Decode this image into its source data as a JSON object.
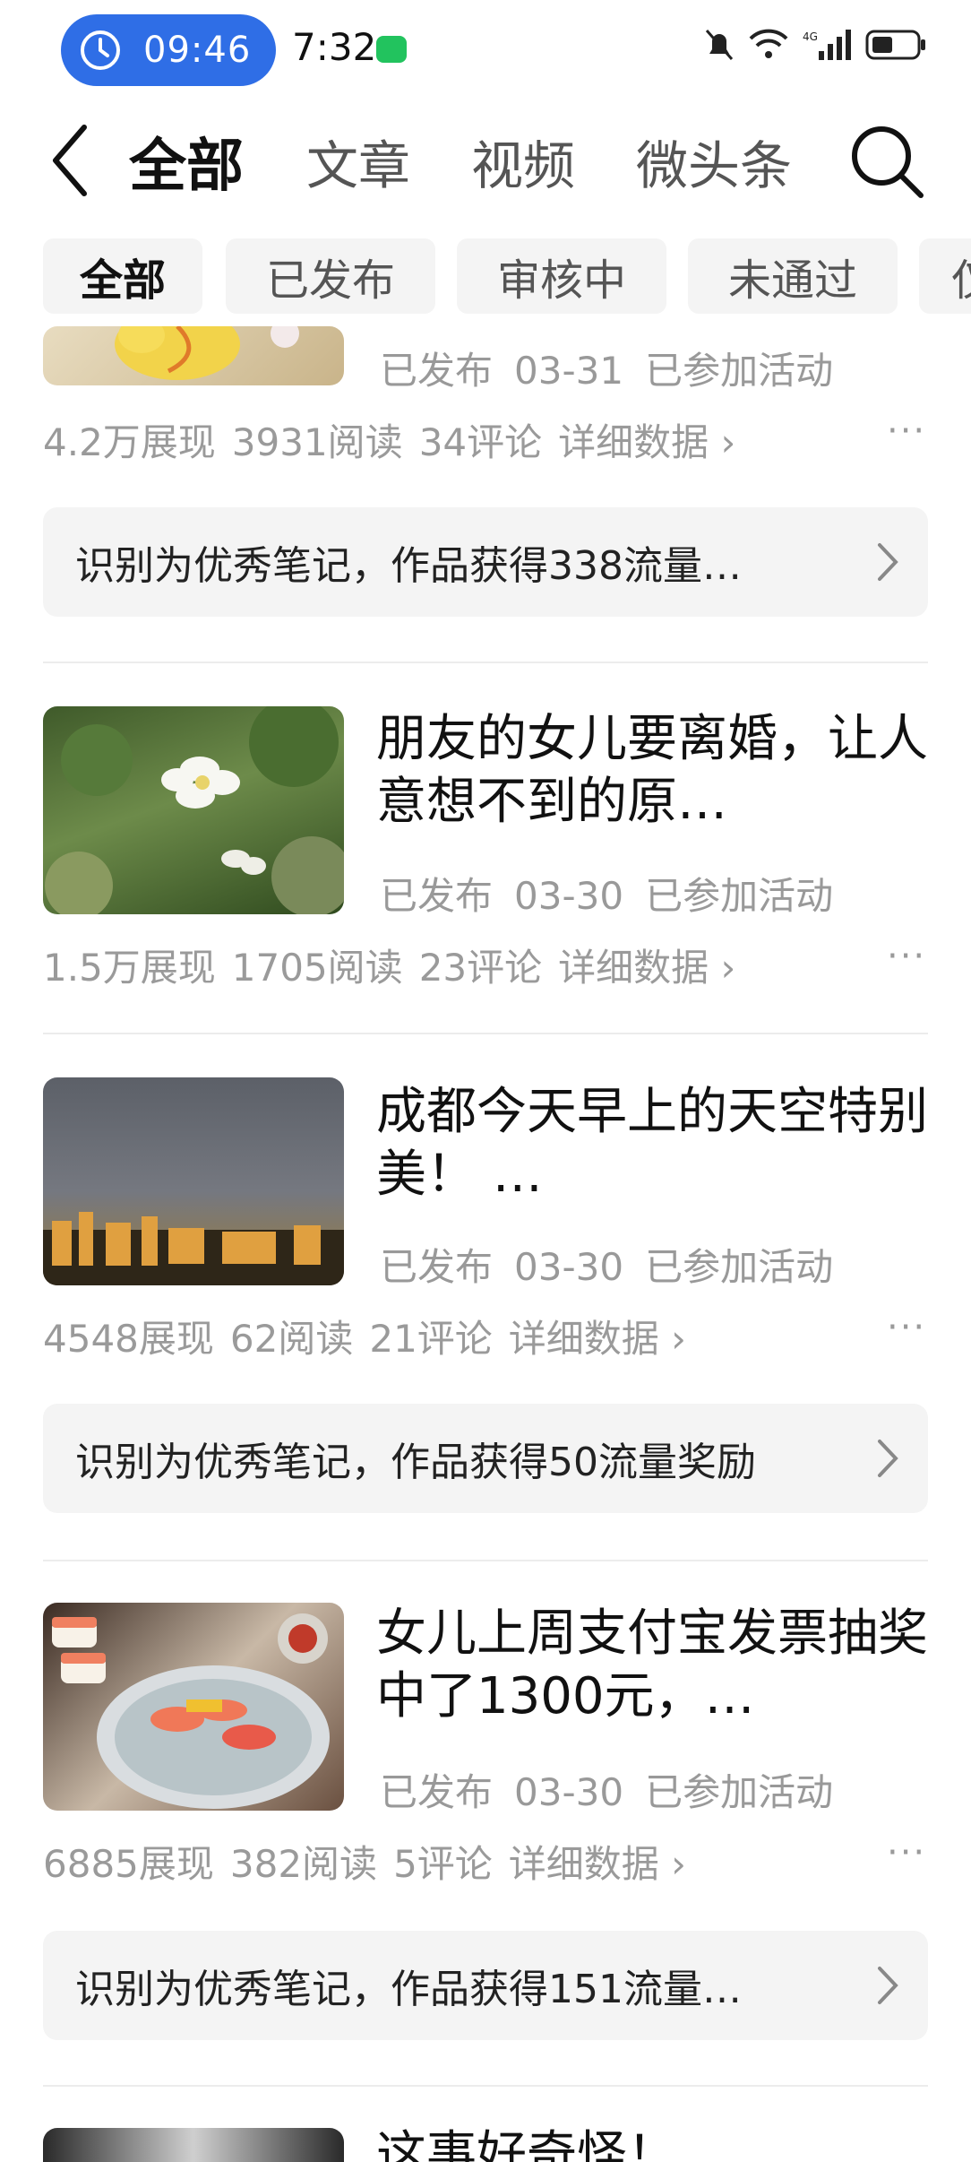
{
  "status_bar": {
    "timer": "09:46",
    "clock": "7:32"
  },
  "nav": {
    "tabs": [
      "全部",
      "文章",
      "视频",
      "微头条"
    ]
  },
  "filters": [
    "全部",
    "已发布",
    "审核中",
    "未通过",
    "仅"
  ],
  "items": [
    {
      "meta": {
        "status": "已发布",
        "date": "03-31",
        "activity": "已参加活动"
      },
      "stats": {
        "impressions": "4.2万展现",
        "reads": "3931阅读",
        "comments": "34评论",
        "detail": "详细数据 ›"
      },
      "reward": "识别为优秀笔记，作品获得338流量…"
    },
    {
      "title": "朋友的女儿要离婚，让人意想不到的原…",
      "meta": {
        "status": "已发布",
        "date": "03-30",
        "activity": "已参加活动"
      },
      "stats": {
        "impressions": "1.5万展现",
        "reads": "1705阅读",
        "comments": "23评论",
        "detail": "详细数据 ›"
      }
    },
    {
      "title": "成都今天早上的天空特别美！ …",
      "meta": {
        "status": "已发布",
        "date": "03-30",
        "activity": "已参加活动"
      },
      "stats": {
        "impressions": "4548展现",
        "reads": "62阅读",
        "comments": "21评论",
        "detail": "详细数据 ›"
      },
      "reward": "识别为优秀笔记，作品获得50流量奖励"
    },
    {
      "title": "女儿上周支付宝发票抽奖中了1300元，…",
      "meta": {
        "status": "已发布",
        "date": "03-30",
        "activity": "已参加活动"
      },
      "stats": {
        "impressions": "6885展现",
        "reads": "382阅读",
        "comments": "5评论",
        "detail": "详细数据 ›"
      },
      "reward": "识别为优秀笔记，作品获得151流量…"
    },
    {
      "title": "这事好奇怪！"
    }
  ],
  "more_label": "···"
}
